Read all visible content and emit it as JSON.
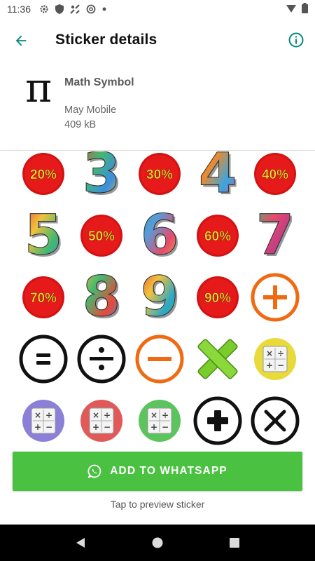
{
  "status_bar": {
    "time": "11:36",
    "icons": [
      "gear-icon",
      "shield-icon",
      "signal-icon",
      "at-icon",
      "dot-icon"
    ],
    "right_icons": [
      "wifi-icon",
      "battery-icon"
    ]
  },
  "app_bar": {
    "title": "Sticker details",
    "back_icon": "arrow-left-icon",
    "info_icon": "info-icon",
    "accent_color": "#00897b"
  },
  "pack": {
    "tray_glyph": "π",
    "name": "Math Symbol",
    "publisher": "May Mobile",
    "size": "409 kB"
  },
  "stickers": [
    {
      "kind": "badge",
      "text": "20%"
    },
    {
      "kind": "digit",
      "text": "3"
    },
    {
      "kind": "badge",
      "text": "30%"
    },
    {
      "kind": "digit",
      "text": "4"
    },
    {
      "kind": "badge",
      "text": "40%"
    },
    {
      "kind": "digit",
      "text": "5"
    },
    {
      "kind": "badge",
      "text": "50%"
    },
    {
      "kind": "digit",
      "text": "6"
    },
    {
      "kind": "badge",
      "text": "60%"
    },
    {
      "kind": "digit",
      "text": "7"
    },
    {
      "kind": "badge",
      "text": "70%"
    },
    {
      "kind": "digit",
      "text": "8"
    },
    {
      "kind": "digit",
      "text": "9"
    },
    {
      "kind": "badge",
      "text": "90%"
    },
    {
      "kind": "plus-orange"
    },
    {
      "kind": "equals-black"
    },
    {
      "kind": "divide-black"
    },
    {
      "kind": "minus-orange"
    },
    {
      "kind": "x-green"
    },
    {
      "kind": "calc",
      "color": "#e8da3a"
    },
    {
      "kind": "calc",
      "color": "#8b7fd8"
    },
    {
      "kind": "calc",
      "color": "#e05a5a"
    },
    {
      "kind": "calc",
      "color": "#5cc45c"
    },
    {
      "kind": "plus-black"
    },
    {
      "kind": "times-black"
    }
  ],
  "actions": {
    "add_label": "ADD TO WHATSAPP",
    "add_color": "#4ac140",
    "hint": "Tap to preview sticker"
  },
  "nav_bar": [
    "back-triangle-icon",
    "home-circle-icon",
    "recents-square-icon"
  ]
}
